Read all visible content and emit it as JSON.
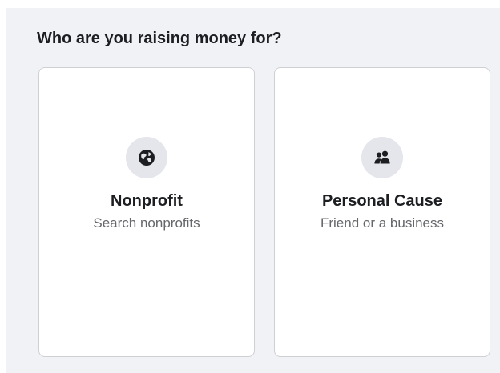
{
  "heading": "Who are you raising money for?",
  "options": [
    {
      "title": "Nonprofit",
      "subtitle": "Search nonprofits",
      "icon": "globe-icon"
    },
    {
      "title": "Personal Cause",
      "subtitle": "Friend or a business",
      "icon": "people-icon"
    }
  ],
  "colors": {
    "panel_background": "#f0f2f5",
    "card_background": "#ffffff",
    "card_border": "#ced0d4",
    "icon_circle": "#e4e6eb",
    "icon_glyph": "#1c1e21",
    "title_text": "#1c1e21",
    "subtitle_text": "#65676b"
  }
}
